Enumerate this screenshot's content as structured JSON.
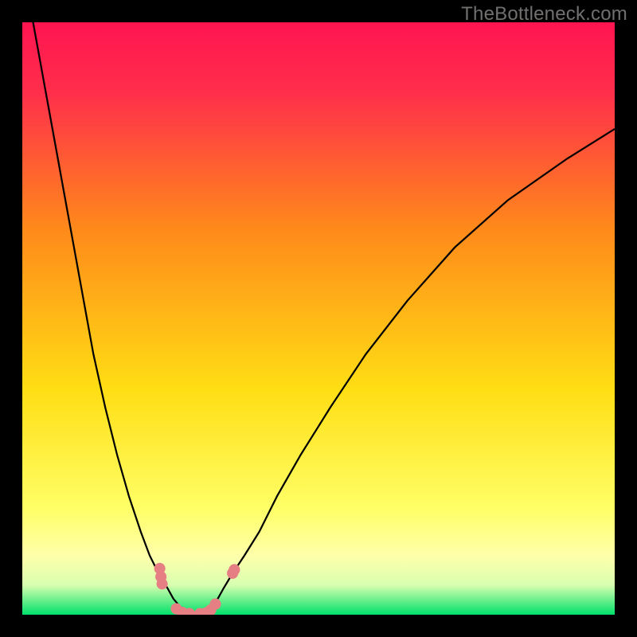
{
  "watermark": "TheBottleneck.com",
  "colors": {
    "background_black": "#000000",
    "grad_top": "#ff1450",
    "grad_mid_orange": "#ff8a1a",
    "grad_yellow": "#ffde14",
    "grad_pale_yellow": "#ffffaa",
    "grad_green": "#00e06a",
    "curve_stroke": "#000000",
    "marker_fill": "#e67f84",
    "marker_stroke": "#e67f84"
  },
  "chart_data": {
    "type": "line",
    "title": "",
    "xlabel": "",
    "ylabel": "",
    "xlim": [
      0,
      100
    ],
    "ylim": [
      0,
      100
    ],
    "series": [
      {
        "name": "left-curve",
        "x": [
          0,
          2,
          4,
          6,
          8,
          10,
          12,
          14,
          16,
          18,
          20,
          21.5,
          23,
          24.5,
          25.5,
          26.5,
          27.5,
          28
        ],
        "y": [
          110,
          99,
          88,
          77,
          66,
          55,
          44,
          35,
          27,
          20,
          14,
          10,
          7,
          4.5,
          2.7,
          1.5,
          0.7,
          0.2
        ]
      },
      {
        "name": "right-curve",
        "x": [
          31,
          31.5,
          32.2,
          33,
          34,
          35.5,
          37.5,
          40,
          43,
          47,
          52,
          58,
          65,
          73,
          82,
          92,
          100
        ],
        "y": [
          0.2,
          0.7,
          1.5,
          2.7,
          4.5,
          7,
          10,
          14,
          20,
          27,
          35,
          44,
          53,
          62,
          70,
          77,
          82
        ]
      }
    ],
    "valley_floor": {
      "x_start": 28,
      "x_end": 31,
      "y": 0
    },
    "markers": [
      {
        "x": 23.2,
        "y": 7.8
      },
      {
        "x": 23.4,
        "y": 6.4
      },
      {
        "x": 23.6,
        "y": 5.2
      },
      {
        "x": 26.0,
        "y": 1.0
      },
      {
        "x": 27.0,
        "y": 0.4
      },
      {
        "x": 28.2,
        "y": 0.2
      },
      {
        "x": 30.0,
        "y": 0.2
      },
      {
        "x": 31.0,
        "y": 0.3
      },
      {
        "x": 31.8,
        "y": 0.8
      },
      {
        "x": 32.6,
        "y": 1.8
      },
      {
        "x": 35.5,
        "y": 7.0
      },
      {
        "x": 35.8,
        "y": 7.6
      }
    ],
    "marker_radius_pct": 0.9
  }
}
